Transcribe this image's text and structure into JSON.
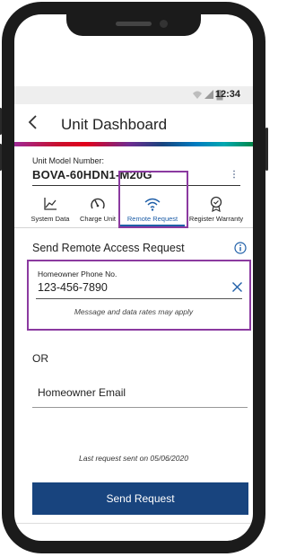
{
  "status_bar": {
    "time": "12:34",
    "icons": [
      "wifi-icon",
      "signal-icon",
      "battery-icon"
    ]
  },
  "header": {
    "back_icon": "chevron-left-icon",
    "title": "Unit Dashboard"
  },
  "unit": {
    "model_label": "Unit Model Number:",
    "model_value": "BOVA-60HDN1-M20G",
    "menu_icon": "more-vertical-icon"
  },
  "tabs": [
    {
      "label": "System Data",
      "icon": "chart-icon",
      "active": false
    },
    {
      "label": "Charge Unit",
      "icon": "gauge-icon",
      "active": false
    },
    {
      "label": "Remote Request",
      "icon": "wifi-icon",
      "active": true
    },
    {
      "label": "Register Warranty",
      "icon": "award-badge-icon",
      "active": false
    }
  ],
  "remote_request": {
    "section_title": "Send Remote Access Request",
    "phone_label": "Homeowner Phone No.",
    "phone_value": "123-456-7890",
    "phone_hint": "Message and data rates may apply",
    "or_label": "OR",
    "email_placeholder": "Homeowner Email",
    "last_request": "Last request sent on 05/06/2020",
    "send_label": "Send Request"
  },
  "colors": {
    "brand_blue": "#18447e",
    "active_tab": "#1f5fa8",
    "highlight": "#8b3aa0"
  }
}
